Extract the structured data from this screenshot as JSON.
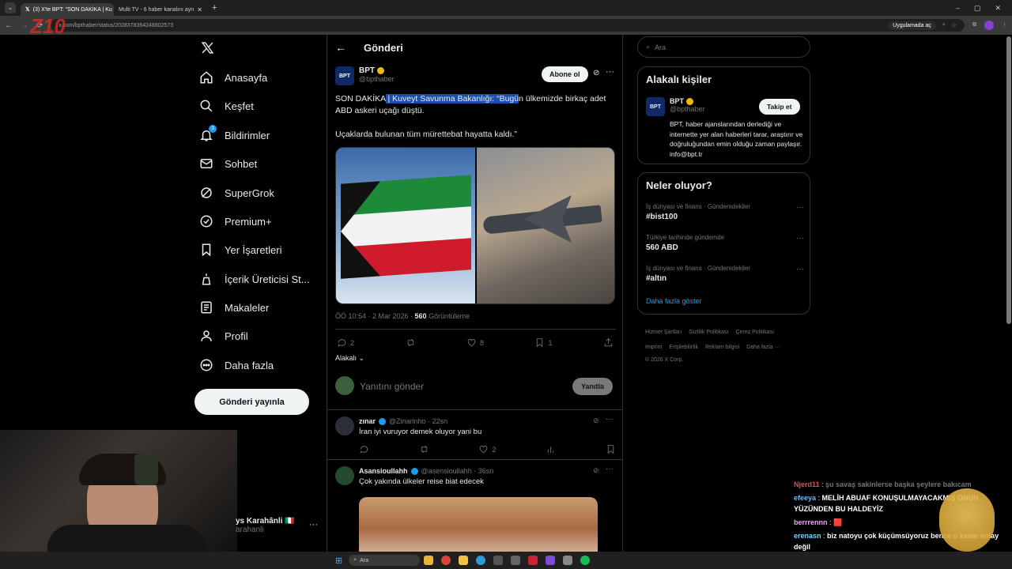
{
  "browser": {
    "tabs": [
      {
        "label": "(3) X'te BPT: \"SON DAKİKA | Ku"
      },
      {
        "label": "Multi TV - 6 haber kanalını ayn"
      }
    ],
    "new_tab": "+",
    "url": "x.com/bpthaber/status/2028378354248802573",
    "open_in_app": "Uygulamada aç"
  },
  "nav": {
    "items": [
      {
        "label": "Anasayfa",
        "icon": "home-icon"
      },
      {
        "label": "Keşfet",
        "icon": "search-icon"
      },
      {
        "label": "Bildirimler",
        "icon": "bell-icon",
        "badge": "3"
      },
      {
        "label": "Sohbet",
        "icon": "mail-icon"
      },
      {
        "label": "SuperGrok",
        "icon": "grok-icon"
      },
      {
        "label": "Premium+",
        "icon": "verified-icon"
      },
      {
        "label": "Yer İşaretleri",
        "icon": "bookmark-icon"
      },
      {
        "label": "İçerik Üreticisi St...",
        "icon": "creator-icon"
      },
      {
        "label": "Makaleler",
        "icon": "article-icon"
      },
      {
        "label": "Profil",
        "icon": "profile-icon"
      },
      {
        "label": "Daha fazla",
        "icon": "more-circle-icon"
      }
    ],
    "post_button": "Gönderi yayınla",
    "account_name": "ys Karahânli 🇮🇹",
    "account_handle": "arahanli"
  },
  "post": {
    "header": "Gönderi",
    "author": "BPT",
    "handle": "@bpthaber",
    "subscribe": "Abone ol",
    "text_prefix": "SON DAKİKA",
    "text_highlight": " | Kuveyt Savunma Bakanlığı: “Bugü",
    "text_rest": "n ülkemizde birkaç adet ABD askeri uçağı düştü.",
    "text_para2": "Uçaklarda bulunan tüm mürettebat hayatta kaldı.”",
    "time": "ÖÖ 10:54 · 2 Mar 2026 · ",
    "views": "560",
    "views_label": "Görüntüleme",
    "replies": "2",
    "likes": "8",
    "bookmarks": "1",
    "relevant": "Alakalı",
    "reply_placeholder": "Yanıtını gönder",
    "reply_button": "Yanıtla"
  },
  "replies": [
    {
      "name": "zınar",
      "handle": "@Zinarinho · 22sn",
      "text": "İran iyi vuruyor demek oluyor yani bu",
      "likes": "2"
    },
    {
      "name": "Asansioullahh",
      "handle": "@asensioullahh · 36sn",
      "text": "Çok yakında ülkeler reise biat edecek"
    }
  ],
  "search": {
    "placeholder": "Ara"
  },
  "related": {
    "title": "Alakalı kişiler",
    "name": "BPT",
    "handle": "@bpthaber",
    "follow": "Takip et",
    "bio": "BPT, haber ajanslarından derlediği ve internette yer alan haberleri tarar, araştırır ve doğruluğundan emin olduğu zaman paylaşır. info@bpt.tr"
  },
  "trends": {
    "title": "Neler oluyor?",
    "items": [
      {
        "category": "İş dünyası ve finans · Gündemdekiler",
        "name": "#bist100"
      },
      {
        "category": "Türkiye tarihinde gündemde",
        "name": "560 ABD"
      },
      {
        "category": "İş dünyası ve finans · Gündemdekiler",
        "name": "#altın"
      }
    ],
    "show_more": "Daha fazla göster"
  },
  "footer": {
    "links": [
      "Hizmet Şartları",
      "Gizlilik Politikası",
      "Çerez Politikası",
      "Imprint",
      "Erişilebilirlik",
      "Reklam bilgisi",
      "Daha fazla ···"
    ],
    "copyright": "© 2026 X Corp."
  },
  "chat": [
    {
      "user": "Njerd11",
      "msg": "şu savaş sakinlerse başka şeylere bakıcam",
      "color": "#d9534f"
    },
    {
      "user": "efeeya",
      "msg": "MELİH ABUAF KONUŞULMAYACAKMIŞ ONUN YÜZÜNDEN BU HALDEYİZ",
      "color": "#6fb6ff"
    },
    {
      "user": "berrrennn",
      "msg": "🟥",
      "color": "#e9a3ff"
    },
    {
      "user": "erenasn",
      "msg": "biz natoyu çok küçümsüyoruz bence o kadar kolay değil",
      "color": "#7fd1ff"
    }
  ],
  "taskbar": {
    "search": "Ara"
  },
  "colors": {
    "accent": "#1d9bf0",
    "highlight": "#1e4fa8",
    "verified": "#f5b800"
  }
}
